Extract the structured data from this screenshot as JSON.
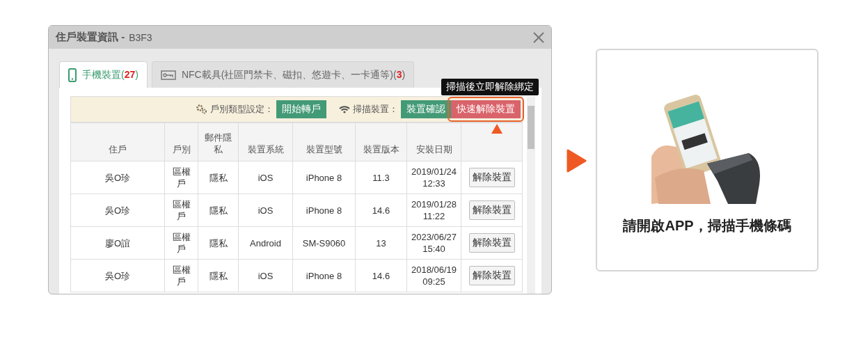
{
  "dialog": {
    "title": "住戶裝置資訊 -",
    "subtitle": "B3F3",
    "tabs": [
      {
        "label": "手機裝置(**27**)",
        "selected": true
      },
      {
        "label": "NFC載具(社區門禁卡、磁扣、悠遊卡、一卡通等)(**3**)",
        "selected": false
      }
    ],
    "toolbar": [
      {
        "label": "戶別類型設定：",
        "buttons": [
          {
            "label": "開始轉戶",
            "kind": "green",
            "highlighted": false
          }
        ]
      },
      {
        "label": "掃描裝置：",
        "buttons": [
          {
            "label": "裝置確認",
            "kind": "green",
            "highlighted": false
          },
          {
            "label": "快速解除裝置",
            "kind": "red",
            "highlighted": true
          }
        ]
      }
    ],
    "tooltip": "掃描後立即解除綁定",
    "table": {
      "columns": [
        "住戶",
        "戶別",
        "郵件隱私",
        "裝置系統",
        "裝置型號",
        "裝置版本",
        "安裝日期"
      ],
      "rows": [
        {
          "cells": [
            "吳O珍",
            "區權戶",
            "隱私",
            "iOS",
            "iPhone 8",
            "11.3",
            "2019/01/24 12:33"
          ],
          "action": "解除裝置"
        },
        {
          "cells": [
            "吳O珍",
            "區權戶",
            "隱私",
            "iOS",
            "iPhone 8",
            "14.6",
            "2019/01/28 11:22"
          ],
          "action": "解除裝置"
        },
        {
          "cells": [
            "廖O誼",
            "區權戶",
            "隱私",
            "Android",
            "SM-S9060",
            "13",
            "2023/06/27 15:40"
          ],
          "action": "解除裝置"
        },
        {
          "cells": [
            "吳O珍",
            "區權戶",
            "隱私",
            "iOS",
            "iPhone 8",
            "14.6",
            "2018/06/19 09:25"
          ],
          "action": "解除裝置"
        }
      ]
    }
  },
  "card": {
    "caption": "請開啟APP，掃描手機條碼"
  }
}
